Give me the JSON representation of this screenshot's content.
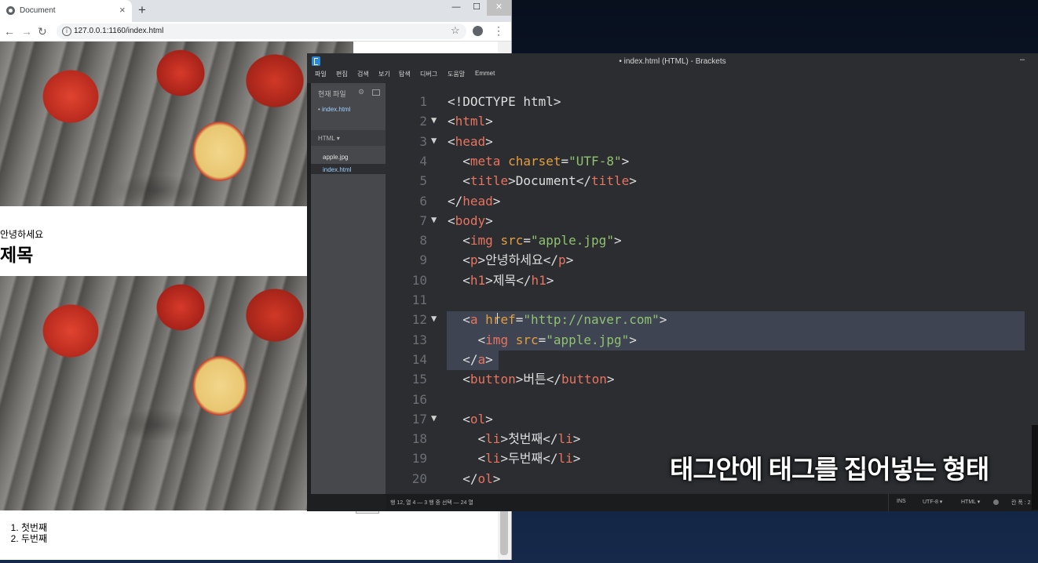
{
  "browser": {
    "tab_title": "Document",
    "tab_close": "×",
    "new_tab": "+",
    "win_min": "—",
    "win_max": "☐",
    "win_close": "✕",
    "nav_back": "←",
    "nav_forward": "→",
    "nav_reload": "↻",
    "url": "127.0.0.1:1160/index.html",
    "info_icon": "i",
    "star_icon": "☆",
    "menu_icon": "⋮",
    "page": {
      "paragraph": "안녕하세요",
      "heading": "제목",
      "list": [
        "첫번째",
        "두번째"
      ]
    }
  },
  "brackets": {
    "title": "• index.html (HTML) - Brackets",
    "min": "–",
    "menu": [
      "파일",
      "편집",
      "검색",
      "보기",
      "탐색",
      "디버그",
      "도움말",
      "Emmet"
    ],
    "sidebar": {
      "working_files_header": "현재 파일",
      "gear_icon": "⚙",
      "working_file": "index.html",
      "project_name": "HTML ▾",
      "files": [
        "apple.jpg",
        "index.html"
      ]
    },
    "code_lines": [
      {
        "n": "1",
        "fold": "",
        "segs": [
          [
            "pun",
            "<!DOCTYPE html>"
          ]
        ]
      },
      {
        "n": "2",
        "fold": "▼",
        "segs": [
          [
            "pun",
            "<"
          ],
          [
            "tag",
            "html"
          ],
          [
            "pun",
            ">"
          ]
        ]
      },
      {
        "n": "3",
        "fold": "▼",
        "segs": [
          [
            "pun",
            "<"
          ],
          [
            "tag",
            "head"
          ],
          [
            "pun",
            ">"
          ]
        ]
      },
      {
        "n": "4",
        "fold": "",
        "segs": [
          [
            "pun",
            "  <"
          ],
          [
            "tag",
            "meta "
          ],
          [
            "attr",
            "charset"
          ],
          [
            "pun",
            "="
          ],
          [
            "str",
            "\"UTF-8\""
          ],
          [
            "pun",
            ">"
          ]
        ]
      },
      {
        "n": "5",
        "fold": "",
        "segs": [
          [
            "pun",
            "  <"
          ],
          [
            "tag",
            "title"
          ],
          [
            "pun",
            ">Document</"
          ],
          [
            "tag",
            "title"
          ],
          [
            "pun",
            ">"
          ]
        ]
      },
      {
        "n": "6",
        "fold": "",
        "segs": [
          [
            "pun",
            "</"
          ],
          [
            "tag",
            "head"
          ],
          [
            "pun",
            ">"
          ]
        ]
      },
      {
        "n": "7",
        "fold": "▼",
        "segs": [
          [
            "pun",
            "<"
          ],
          [
            "tag",
            "body"
          ],
          [
            "pun",
            ">"
          ]
        ]
      },
      {
        "n": "8",
        "fold": "",
        "segs": [
          [
            "pun",
            "  <"
          ],
          [
            "tag",
            "img "
          ],
          [
            "attr",
            "src"
          ],
          [
            "pun",
            "="
          ],
          [
            "str",
            "\"apple.jpg\""
          ],
          [
            "pun",
            ">"
          ]
        ]
      },
      {
        "n": "9",
        "fold": "",
        "segs": [
          [
            "pun",
            "  <"
          ],
          [
            "tag",
            "p"
          ],
          [
            "pun",
            ">안녕하세요</"
          ],
          [
            "tag",
            "p"
          ],
          [
            "pun",
            ">"
          ]
        ]
      },
      {
        "n": "10",
        "fold": "",
        "segs": [
          [
            "pun",
            "  <"
          ],
          [
            "tag",
            "h1"
          ],
          [
            "pun",
            ">제목</"
          ],
          [
            "tag",
            "h1"
          ],
          [
            "pun",
            ">"
          ]
        ]
      },
      {
        "n": "11",
        "fold": "",
        "segs": []
      },
      {
        "n": "12",
        "fold": "▼",
        "segs": [
          [
            "pun",
            "  <"
          ],
          [
            "tag",
            "a "
          ],
          [
            "attr",
            "href"
          ],
          [
            "pun",
            "="
          ],
          [
            "str",
            "\"http://naver.com\""
          ],
          [
            "pun",
            ">"
          ]
        ]
      },
      {
        "n": "13",
        "fold": "",
        "segs": [
          [
            "pun",
            "    <"
          ],
          [
            "tag",
            "img "
          ],
          [
            "attr",
            "src"
          ],
          [
            "pun",
            "="
          ],
          [
            "str",
            "\"apple.jpg\""
          ],
          [
            "pun",
            ">"
          ]
        ]
      },
      {
        "n": "14",
        "fold": "",
        "segs": [
          [
            "pun",
            "  </"
          ],
          [
            "tag",
            "a"
          ],
          [
            "pun",
            ">"
          ]
        ]
      },
      {
        "n": "15",
        "fold": "",
        "segs": [
          [
            "pun",
            "  <"
          ],
          [
            "tag",
            "button"
          ],
          [
            "pun",
            ">버튼</"
          ],
          [
            "tag",
            "button"
          ],
          [
            "pun",
            ">"
          ]
        ]
      },
      {
        "n": "16",
        "fold": "",
        "segs": []
      },
      {
        "n": "17",
        "fold": "▼",
        "segs": [
          [
            "pun",
            "  <"
          ],
          [
            "tag",
            "ol"
          ],
          [
            "pun",
            ">"
          ]
        ]
      },
      {
        "n": "18",
        "fold": "",
        "segs": [
          [
            "pun",
            "    <"
          ],
          [
            "tag",
            "li"
          ],
          [
            "pun",
            ">첫번째</"
          ],
          [
            "tag",
            "li"
          ],
          [
            "pun",
            ">"
          ]
        ]
      },
      {
        "n": "19",
        "fold": "",
        "segs": [
          [
            "pun",
            "    <"
          ],
          [
            "tag",
            "li"
          ],
          [
            "pun",
            ">두번째</"
          ],
          [
            "tag",
            "li"
          ],
          [
            "pun",
            ">"
          ]
        ]
      },
      {
        "n": "20",
        "fold": "",
        "segs": [
          [
            "pun",
            "  </"
          ],
          [
            "tag",
            "ol"
          ],
          [
            "pun",
            ">"
          ]
        ]
      }
    ],
    "status": {
      "position": "행 12, 열 4 — 3 행 중 선택 — 24 열",
      "ins": "INS",
      "encoding": "UTF-8 ▾",
      "language": "HTML ▾",
      "spaces": "칸 폭 : 2"
    }
  },
  "subtitle": "태그안에 태그를 집어넣는 형태",
  "colors": {
    "tag": "#e8735e",
    "attr": "#e49e3e",
    "string": "#90c26f",
    "selection": "#3e4451"
  }
}
